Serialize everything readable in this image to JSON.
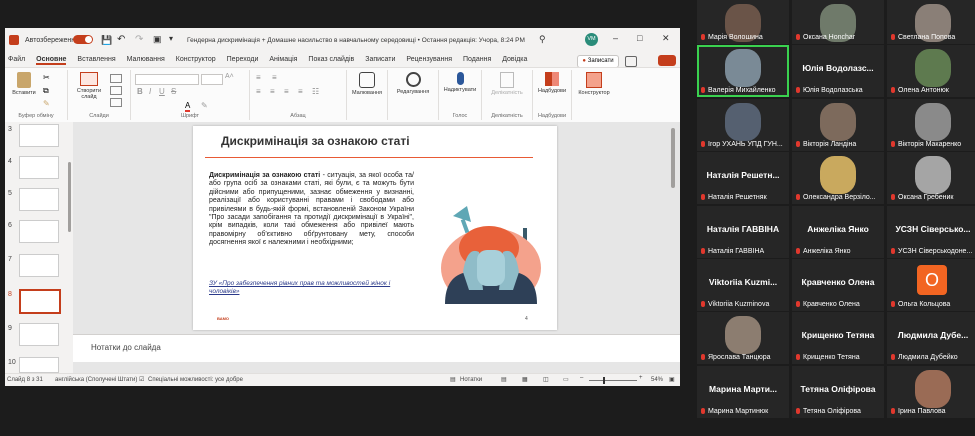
{
  "window": {
    "autosave_label": "Автозбереження",
    "toggle_label": "Вкл",
    "title": "Гендерна дискримінація + Домашне насильство в навчальному середовищі • Остання редакція: Учора, 8:24 PM",
    "avatar_initials": "VM"
  },
  "tabs": [
    "Файл",
    "Основне",
    "Вставлення",
    "Малювання",
    "Конструктор",
    "Переходи",
    "Анімація",
    "Показ слайдів",
    "Записати",
    "Рецензування",
    "Подання",
    "Довідка"
  ],
  "ribbon": {
    "record_button": "Записати",
    "groups": {
      "clipboard": "Буфер обміну",
      "slides": "Слайди",
      "font": "Шрифт",
      "paragraph": "Абзац",
      "voice": "Голос",
      "sensitivity": "Делікатність",
      "addins": "Надбудови"
    },
    "buttons": {
      "paste": "Вставити",
      "new_slide": "Створити слайд",
      "drawing": "Малювання",
      "editing": "Редагування",
      "dictate": "Надиктувати",
      "sensitivity": "Делікатність",
      "addins": "Надбудови",
      "designer": "Конструктор"
    }
  },
  "thumbnails": [
    "3",
    "4",
    "5",
    "6",
    "7",
    "8",
    "9",
    "10"
  ],
  "slide": {
    "title": "Дискримінація за ознакою статі",
    "lead": "Дискримінація за ознакою статі",
    "body": " - ситуація, за якої особа та/або група осіб за ознаками статі, які були, є та можуть бути дійсними або припущеними, зазнає обмеження у визнанні, реалізації або користуванні правами і свободами або привілеями в будь-якій формі, встановленій Законом України \"Про засади запобігання та протидії дискримінації в Україні\", крім випадків, коли такі обмеження або привілеї мають правомірну об'єктивно обґрунтовану мету, способи досягнення якої є належними і необхідними;",
    "source": "ЗУ «Про забезпечення рівних прав та можливостей жінок і чоловіків»",
    "logo": "ВАМО",
    "page_num": "4"
  },
  "notes_placeholder": "Нотатки до слайда",
  "status": {
    "slide_info": "Слайд 8 з 31",
    "language": "англійська (Сполучені Штати)",
    "accessibility": "Спеціальні можливості: усе добре",
    "notes": "Нотатки",
    "zoom": "54%"
  },
  "participants": [
    {
      "name": "Марія Волошина",
      "big": "",
      "colour": "#6a5448"
    },
    {
      "name": "Оксана Honchar",
      "big": "",
      "colour": "#6f7a6a"
    },
    {
      "name": "Светлана Попова",
      "big": "",
      "colour": "#8a7f77"
    },
    {
      "name": "Валерія Михайленко",
      "big": "",
      "colour": "#7a8a96",
      "active": true
    },
    {
      "name": "Юлія Водолазська",
      "big": "Юлія Водолазс...",
      "colour": "#262626"
    },
    {
      "name": "Олена Антонюк",
      "big": "",
      "colour": "#5e7a4f"
    },
    {
      "name": "Ігор УХАНЬ УПД ГУН...",
      "big": "",
      "colour": "#556070"
    },
    {
      "name": "Вікторія Ландіна",
      "big": "",
      "colour": "#7d6a5c"
    },
    {
      "name": "Вікторія Макаренко",
      "big": "",
      "colour": "#8a8a8a"
    },
    {
      "name": "Наталія Решетняк",
      "big": "Наталія Решетн...",
      "colour": "#262626"
    },
    {
      "name": "Олександра Верзіло...",
      "big": "",
      "colour": "#c9a95e"
    },
    {
      "name": "Оксана Гребеник",
      "big": "",
      "colour": "#a5a5a5"
    },
    {
      "name": "Наталія ГАВВІНА",
      "big": "Наталія ГАВВІНА",
      "colour": "#262626"
    },
    {
      "name": "Анжеліка Янко",
      "big": "Анжеліка Янко",
      "colour": "#262626"
    },
    {
      "name": "УСЗН Сіверськодоне...",
      "big": "УСЗН Сіверсько...",
      "colour": "#262626"
    },
    {
      "name": "Viktoriia Kuzminova",
      "big": "Viktoriia Kuzmi...",
      "colour": "#262626"
    },
    {
      "name": "Кравченко Олена",
      "big": "Кравченко Олена",
      "colour": "#262626"
    },
    {
      "name": "Ольга Кольцова",
      "big": "",
      "colour": "#262626",
      "avatar": "О"
    },
    {
      "name": "Ярослава Танцюра",
      "big": "",
      "colour": "#8c7d70"
    },
    {
      "name": "Крищенко Тетяна",
      "big": "Крищенко Тетяна",
      "colour": "#262626"
    },
    {
      "name": "Людмила Дубейко",
      "big": "Людмила Дубе...",
      "colour": "#262626"
    },
    {
      "name": "Марина Мартинюк",
      "big": "Марина Марти...",
      "colour": "#262626"
    },
    {
      "name": "Тетяна Оліфірова",
      "big": "Тетяна Оліфірова",
      "colour": "#262626"
    },
    {
      "name": "Ірина Павлова",
      "big": "",
      "colour": "#9a6b55"
    }
  ]
}
